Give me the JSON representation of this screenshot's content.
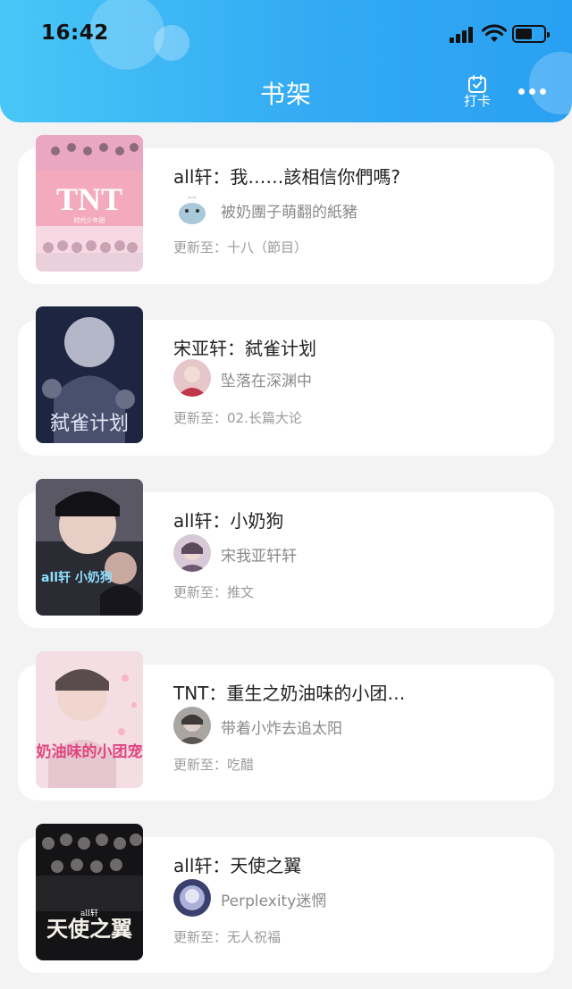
{
  "status_bar": {
    "time": "16:42"
  },
  "header": {
    "title": "书架",
    "checkin_label": "打卡",
    "more_icon": "more-dots-icon",
    "colors": {
      "gradient_start": "#49c6f7",
      "gradient_end": "#2aa0f2"
    }
  },
  "update_prefix": "更新至：",
  "books": [
    {
      "title": "all轩：我……該相信你們嗎?",
      "author": "被奶團子萌翻的紙豬",
      "update": "十八（節目）"
    },
    {
      "title": "宋亚轩：弑雀计划",
      "author": "坠落在深渊中",
      "update": "02.长篇大论"
    },
    {
      "title": "all轩：小奶狗",
      "author": "宋我亚轩轩",
      "update": "推文"
    },
    {
      "title": "TNT：重生之奶油味的小团…",
      "author": "带着小炸去追太阳",
      "update": "吃醋"
    },
    {
      "title": "all轩：天使之翼",
      "author": "Perplexity迷惘",
      "update": "无人祝福"
    }
  ],
  "covers": [
    {
      "text": "TNT",
      "subtext": "时代少年团"
    },
    {
      "text": "弑雀计划"
    },
    {
      "text": "all轩 小奶狗"
    },
    {
      "text": "奶油味的小团宠"
    },
    {
      "text": "天使之翼",
      "subtext": "all轩"
    }
  ]
}
